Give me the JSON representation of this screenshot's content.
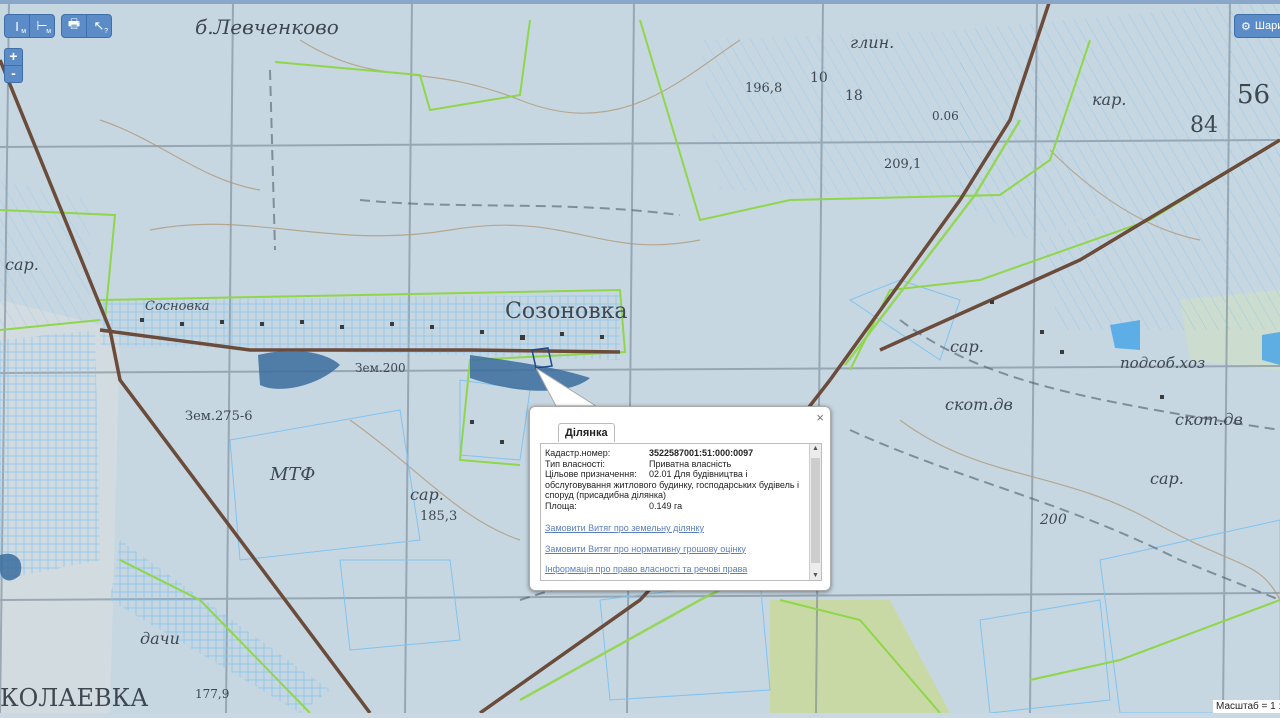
{
  "map_labels": {
    "village_top": "б.Левченково",
    "village_main": "Созоновка",
    "village_sub": "Сосновка",
    "village_bottom": "КОЛАЕВКА",
    "mtf": "МТФ",
    "sar1": "сар.",
    "sar2": "сар.",
    "sar3": "сар.",
    "sar4": "сар.",
    "podsob": "подсоб.хоз",
    "skot1": "скот.дв",
    "skot2": "скот.дв",
    "dachi": "дачи",
    "zem200": "Зем.200",
    "zem275": "Зем.275-6",
    "h185": "185,3",
    "h209": "209,1",
    "h196": "196,8",
    "h177": "177,9",
    "n56": "56",
    "n84": "84",
    "n200": "200",
    "n10": "10",
    "n18": "18",
    "kar": "кар.",
    "glin": "глин.",
    "n006": "0.06"
  },
  "toolbar": {
    "measure_line": "I",
    "measure_area": "⊢",
    "print": "🖶",
    "help": "?",
    "zoom_in": "+",
    "zoom_out": "-",
    "layers_label": "Шари"
  },
  "popup": {
    "close": "×",
    "tab_title": "Ділянка",
    "rows": [
      {
        "key": "Кадастр.номер:",
        "value": "3522587001:51:000:0097"
      },
      {
        "key": "Тип власності:",
        "value": "Приватна власність"
      },
      {
        "key": "Цільове призначення:",
        "value": "02.01 Для будівництва і обслуговування житлового будинку, господарських будівель і споруд (присадибна ділянка)"
      },
      {
        "key": "Площа:",
        "value": "0.149 га"
      }
    ],
    "links": [
      "Замовити Витяг про земельну ділянку",
      "Замовити Витяг про нормативну грошову оцінку",
      "Інформація про право власності та речові права"
    ]
  },
  "scale_label": "Масштаб = 1 :",
  "colors": {
    "parcel_outline": "#7fc3f0",
    "boundary_green": "#8fd64a",
    "water": "#3b6d9e",
    "road": "#6b4b3a",
    "button": "#5b8cc7"
  }
}
